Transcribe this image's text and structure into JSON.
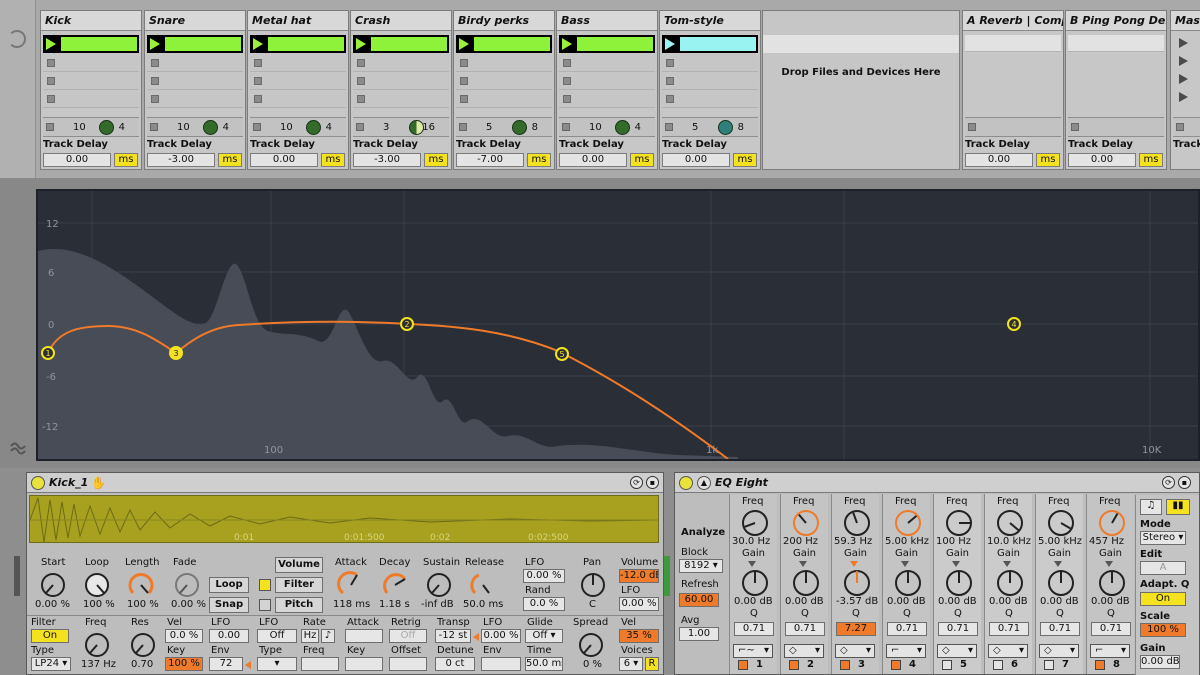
{
  "session": {
    "tracks": [
      {
        "name": "Kick",
        "clip_color": "#8ef23a",
        "send1": "10",
        "send2": "4",
        "track_delay_label": "Track Delay",
        "delay_value": "0.00",
        "delay_unit": "ms"
      },
      {
        "name": "Snare",
        "clip_color": "#8ef23a",
        "send1": "10",
        "send2": "4",
        "track_delay_label": "Track Delay",
        "delay_value": "-3.00",
        "delay_unit": "ms"
      },
      {
        "name": "Metal hat",
        "clip_color": "#8ef23a",
        "send1": "10",
        "send2": "4",
        "track_delay_label": "Track Delay",
        "delay_value": "0.00",
        "delay_unit": "ms"
      },
      {
        "name": "Crash",
        "clip_color": "#8ef23a",
        "send1": "3",
        "send2": "16",
        "track_delay_label": "Track Delay",
        "delay_value": "-3.00",
        "delay_unit": "ms"
      },
      {
        "name": "Birdy perks",
        "clip_color": "#8ef23a",
        "send1": "5",
        "send2": "8",
        "track_delay_label": "Track Delay",
        "delay_value": "-7.00",
        "delay_unit": "ms"
      },
      {
        "name": "Bass",
        "clip_color": "#8ef23a",
        "send1": "10",
        "send2": "4",
        "track_delay_label": "Track Delay",
        "delay_value": "0.00",
        "delay_unit": "ms"
      },
      {
        "name": "Tom-style",
        "clip_color": "#99f3f1",
        "send1": "5",
        "send2": "8",
        "track_delay_label": "Track Delay",
        "delay_value": "0.00",
        "delay_unit": "ms"
      }
    ],
    "drop_text": "Drop Files and Devices Here",
    "returns": [
      {
        "name": "A Reverb | Comp",
        "track_delay_label": "Track Delay",
        "delay_value": "0.00",
        "delay_unit": "ms"
      },
      {
        "name": "B Ping Pong Del",
        "track_delay_label": "Track Delay",
        "delay_value": "0.00",
        "delay_unit": "ms"
      }
    ],
    "master": {
      "name": "Mas",
      "track_delay_label": "Track"
    }
  },
  "eq_display": {
    "y_labels": [
      "12",
      "6",
      "0",
      "-6",
      "-12"
    ],
    "x_labels": [
      "100",
      "1k",
      "10K"
    ],
    "points": [
      "1",
      "3",
      "2",
      "5",
      "4"
    ]
  },
  "simpler": {
    "title": "Kick_1",
    "wave_ticks": [
      "0:01",
      "0:01:500",
      "0:02",
      "0:02:500"
    ],
    "start": {
      "label": "Start",
      "value": "0.00 %"
    },
    "loop": {
      "label": "Loop",
      "value": "100 %"
    },
    "length": {
      "label": "Length",
      "value": "100 %"
    },
    "fade": {
      "label": "Fade",
      "value": "0.00 %"
    },
    "loop_btn": "Loop",
    "snap_btn": "Snap",
    "volume_btn": "Volume",
    "filter_btn": "Filter",
    "pitch_btn": "Pitch",
    "attack": {
      "label": "Attack",
      "value": "118 ms"
    },
    "decay": {
      "label": "Decay",
      "value": "1.18 s"
    },
    "sustain": {
      "label": "Sustain",
      "value": "-inf dB"
    },
    "release": {
      "label": "Release",
      "value": "50.0 ms"
    },
    "lfo_label": "LFO",
    "lfo_value": "0.00 %",
    "rand_label": "Rand",
    "rand_value": "0.0 %",
    "pan": {
      "label": "Pan",
      "value": "C"
    },
    "volume": {
      "label": "Volume",
      "value": "-12.0 dB"
    },
    "vol_lfo_label": "LFO",
    "vol_lfo_value": "0.00 %",
    "filter": {
      "label": "Filter",
      "state": "On",
      "type_label": "Type",
      "type_value": "LP24"
    },
    "freq": {
      "label": "Freq",
      "value": "137 Hz"
    },
    "res": {
      "label": "Res",
      "value": "0.70"
    },
    "vel": {
      "label": "Vel",
      "value": "0.0 %"
    },
    "key": {
      "label": "Key",
      "value": "100 %"
    },
    "flfo": {
      "label": "LFO",
      "value": "0.00"
    },
    "env": {
      "label": "Env",
      "value": "72"
    },
    "lfo2": {
      "label": "LFO",
      "state": "Off",
      "type_label": "Type"
    },
    "rate": {
      "label": "Rate",
      "hz": "Hz",
      "note": "♪",
      "freq_label": "Freq"
    },
    "attack2": {
      "label": "Attack"
    },
    "key2": {
      "label": "Key"
    },
    "retrig": {
      "label": "Retrig",
      "state": "Off",
      "offset_label": "Offset"
    },
    "transp": {
      "label": "Transp",
      "value": "-12 st"
    },
    "detune": {
      "label": "Detune",
      "value": "0 ct"
    },
    "plfo": {
      "label": "LFO",
      "value": "0.00 %"
    },
    "penv": {
      "label": "Env"
    },
    "glide": {
      "label": "Glide",
      "value": "Off",
      "time_label": "Time",
      "time_value": "50.0 ms"
    },
    "spread": {
      "label": "Spread",
      "value": "0 %"
    },
    "vel2": {
      "label": "Vel",
      "value": "35 %"
    },
    "voices": {
      "label": "Voices",
      "value": "6",
      "r": "R"
    }
  },
  "eq8": {
    "title": "EQ Eight",
    "analyze": "Analyze",
    "block_label": "Block",
    "block_value": "8192",
    "refresh_label": "Refresh",
    "refresh_value": "60.00",
    "avg_label": "Avg",
    "avg_value": "1.00",
    "bands": [
      {
        "num": "1",
        "freq": "30.0 Hz",
        "gain": "0.00 dB",
        "q": "0.71",
        "on": true
      },
      {
        "num": "2",
        "freq": "200 Hz",
        "gain": "0.00 dB",
        "q": "0.71",
        "on": true
      },
      {
        "num": "3",
        "freq": "59.3 Hz",
        "gain": "-3.57 dB",
        "q": "7.27",
        "on": true
      },
      {
        "num": "4",
        "freq": "5.00 kHz",
        "gain": "0.00 dB",
        "q": "0.71",
        "on": true
      },
      {
        "num": "5",
        "freq": "100 Hz",
        "gain": "0.00 dB",
        "q": "0.71",
        "on": false
      },
      {
        "num": "6",
        "freq": "10.0 kHz",
        "gain": "0.00 dB",
        "q": "0.71",
        "on": false
      },
      {
        "num": "7",
        "freq": "5.00 kHz",
        "gain": "0.00 dB",
        "q": "0.71",
        "on": false
      },
      {
        "num": "8",
        "freq": "457 Hz",
        "gain": "0.00 dB",
        "q": "0.71",
        "on": true
      }
    ],
    "freq_label": "Freq",
    "gain_label": "Gain",
    "q_label": "Q",
    "mode_label": "Mode",
    "mode_value": "Stereo",
    "edit_label": "Edit",
    "edit_value": "A",
    "adapt_label": "Adapt. Q",
    "adapt_value": "On",
    "scale_label": "Scale",
    "scale_value": "100 %",
    "gain_out_label": "Gain",
    "gain_out_value": "0.00 dB"
  }
}
